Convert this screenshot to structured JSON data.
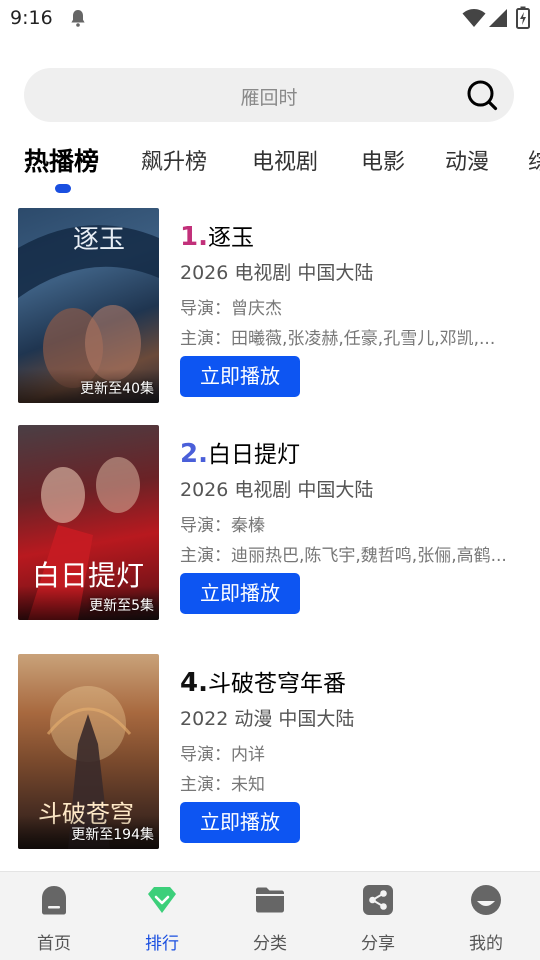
{
  "status_bar": {
    "time": "9:16",
    "icons": [
      "notification-icon",
      "wifi-icon",
      "signal-icon",
      "battery-icon"
    ]
  },
  "search": {
    "placeholder": "雁回时",
    "icon": "search-icon"
  },
  "tabs": [
    {
      "label": "热播榜",
      "active": true
    },
    {
      "label": "飙升榜"
    },
    {
      "label": "电视剧"
    },
    {
      "label": "电影"
    },
    {
      "label": "动漫"
    },
    {
      "label": "综"
    }
  ],
  "colors": {
    "accent": "#0d55f2",
    "rank1": "#c2307a",
    "rank2": "#4a5fd9",
    "rank4": "#111111",
    "nav_active": "#1a4fe0"
  },
  "list": [
    {
      "rank": "1.",
      "title": "逐玉",
      "meta": "2026  电视剧  中国大陆",
      "director": "导演：曾庆杰",
      "cast": "主演：田曦薇,张凌赫,任豪,孔雪儿,邓凯,...",
      "badge": "更新至40集",
      "button": "立即播放",
      "poster_text": "逐玉"
    },
    {
      "rank": "2.",
      "title": "白日提灯",
      "meta": "2026  电视剧  中国大陆",
      "director": "导演：秦榛",
      "cast": "主演：迪丽热巴,陈飞宇,魏哲鸣,张俪,高鹤...",
      "badge": "更新至5集",
      "button": "立即播放",
      "poster_text": "白日提灯"
    },
    {
      "rank": "4.",
      "title": "斗破苍穹年番",
      "meta": "2022  动漫  中国大陆",
      "director": "导演：内详",
      "cast": "主演：未知",
      "badge": "更新至194集",
      "button": "立即播放",
      "poster_text": "斗破苍穹"
    }
  ],
  "bottom_nav": [
    {
      "label": "首页",
      "icon": "home-icon"
    },
    {
      "label": "排行",
      "icon": "diamond-icon",
      "active": true
    },
    {
      "label": "分类",
      "icon": "folder-icon"
    },
    {
      "label": "分享",
      "icon": "share-icon"
    },
    {
      "label": "我的",
      "icon": "profile-icon"
    }
  ]
}
